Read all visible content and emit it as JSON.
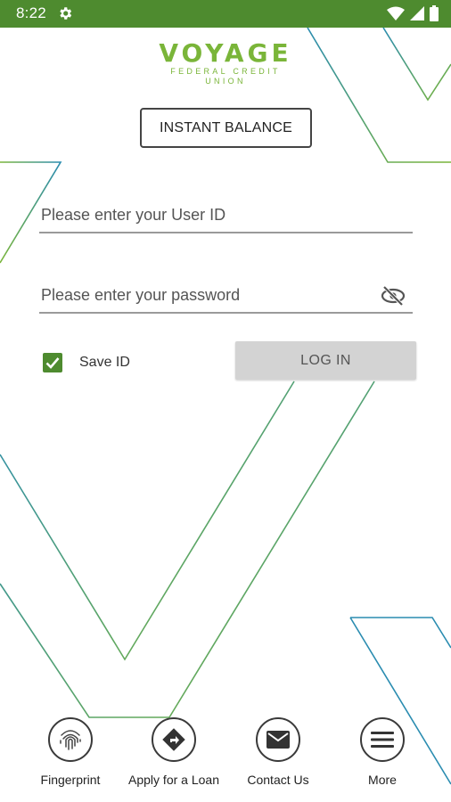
{
  "status_bar": {
    "time": "8:22",
    "color": "#4e8b2f",
    "icons": [
      "gear-icon",
      "wifi-icon",
      "signal-icon",
      "battery-icon"
    ]
  },
  "logo": {
    "name": "VOYAGE",
    "tagline": "FEDERAL CREDIT UNION",
    "color": "#7ab539"
  },
  "instant_balance": {
    "label": "INSTANT BALANCE"
  },
  "login_form": {
    "user_id": {
      "placeholder": "Please enter your User ID",
      "value": ""
    },
    "password": {
      "placeholder": "Please enter your password",
      "value": "",
      "toggle_icon": "eye-off-icon"
    },
    "save_id": {
      "label": "Save ID",
      "checked": true
    },
    "login_button": {
      "label": "LOG IN"
    }
  },
  "bottom_nav": {
    "items": [
      {
        "label": "Fingerprint",
        "icon": "fingerprint-icon"
      },
      {
        "label": "Apply for a Loan",
        "icon": "directions-icon"
      },
      {
        "label": "Contact Us",
        "icon": "envelope-icon"
      },
      {
        "label": "More",
        "icon": "menu-icon"
      }
    ]
  },
  "colors": {
    "brand_green": "#4e8b2f",
    "accent_green": "#7ab539",
    "line_blue": "#2a8cb0"
  }
}
